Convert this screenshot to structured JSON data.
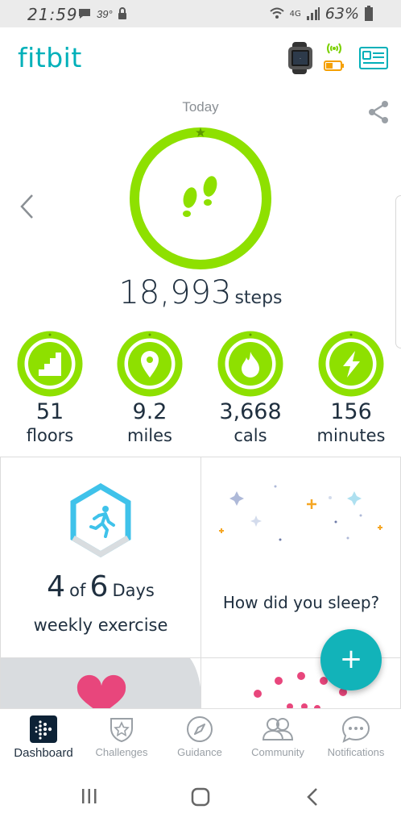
{
  "status_bar": {
    "time": "21:59",
    "temperature": "39°",
    "network": "4G",
    "battery": "63%"
  },
  "header": {
    "logo": "fitbit"
  },
  "day": {
    "label": "Today"
  },
  "steps": {
    "value": "18,993",
    "unit": "steps"
  },
  "stats": [
    {
      "value": "51",
      "label": "floors",
      "icon": "stairs-icon"
    },
    {
      "value": "9.2",
      "label": "miles",
      "icon": "location-pin-icon"
    },
    {
      "value": "3,668",
      "label": "cals",
      "icon": "flame-icon"
    },
    {
      "value": "156",
      "label": "minutes",
      "icon": "lightning-icon"
    }
  ],
  "exercise_tile": {
    "count": "4",
    "of_word": "of",
    "goal": "6",
    "unit": "Days",
    "label": "weekly exercise"
  },
  "sleep_tile": {
    "question": "How did you sleep?"
  },
  "fab": {
    "label": "+"
  },
  "bottom_nav": [
    {
      "label": "Dashboard",
      "icon": "dashboard-icon",
      "active": true
    },
    {
      "label": "Challenges",
      "icon": "challenges-shield-icon",
      "active": false
    },
    {
      "label": "Guidance",
      "icon": "compass-icon",
      "active": false
    },
    {
      "label": "Community",
      "icon": "community-people-icon",
      "active": false
    },
    {
      "label": "Notifications",
      "icon": "chat-bubble-icon",
      "active": false
    }
  ],
  "colors": {
    "brand_teal": "#00b0b9",
    "goal_green": "#8ee000",
    "fab_teal": "#12b3b9",
    "exercise_blue": "#3fc2ea",
    "sleep_navy": "#1d2a5c",
    "heart_pink": "#e8467c",
    "text_dark": "#1f2f3f"
  }
}
